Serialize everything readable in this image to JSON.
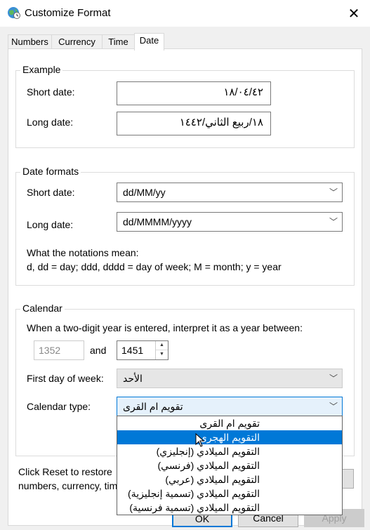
{
  "window": {
    "title": "Customize Format",
    "close_glyph": "✕"
  },
  "tabs": [
    {
      "label": "Numbers"
    },
    {
      "label": "Currency"
    },
    {
      "label": "Time"
    },
    {
      "label": "Date"
    }
  ],
  "example": {
    "group_title": "Example",
    "short_label": "Short date:",
    "short_value": "١٨/٠٤/٤٢",
    "long_label": "Long date:",
    "long_value": "١٨/ربيع الثاني/١٤٤٢"
  },
  "formats": {
    "group_title": "Date formats",
    "short_label": "Short date:",
    "short_value": "dd/MM/yy",
    "long_label": "Long date:",
    "long_value": "dd/MMMM/yyyy",
    "notation_title": "What the notations mean:",
    "notation_text": "d, dd = day;  ddd, dddd = day of week;  M = month;  y = year"
  },
  "calendar": {
    "group_title": "Calendar",
    "two_digit_text": "When a two-digit year is entered, interpret it as a year between:",
    "year_from": "1352",
    "and_label": "and",
    "year_to": "1451",
    "first_day_label": "First day of week:",
    "first_day_value": "الأحد",
    "type_label": "Calendar type:",
    "type_value": "تقويم ام القرى",
    "options": [
      "تقويم ام القرى",
      "التقويم الهجرى",
      "التقويم الميلادي (إنجليزي)",
      "التقويم الميلادي (فرنسي)",
      "التقويم الميلادي (عربي)",
      "التقويم الميلادي (تسمية إنجليزية)",
      "التقويم الميلادي (تسمية فرنسية)"
    ]
  },
  "reset": {
    "text_line1": "Click Reset to restore",
    "text_line2": "numbers, currency, tim"
  },
  "buttons": {
    "ok": "OK",
    "cancel": "Cancel",
    "apply": "Apply"
  },
  "colors": {
    "accent": "#0078d7",
    "selection": "#0078d7"
  }
}
